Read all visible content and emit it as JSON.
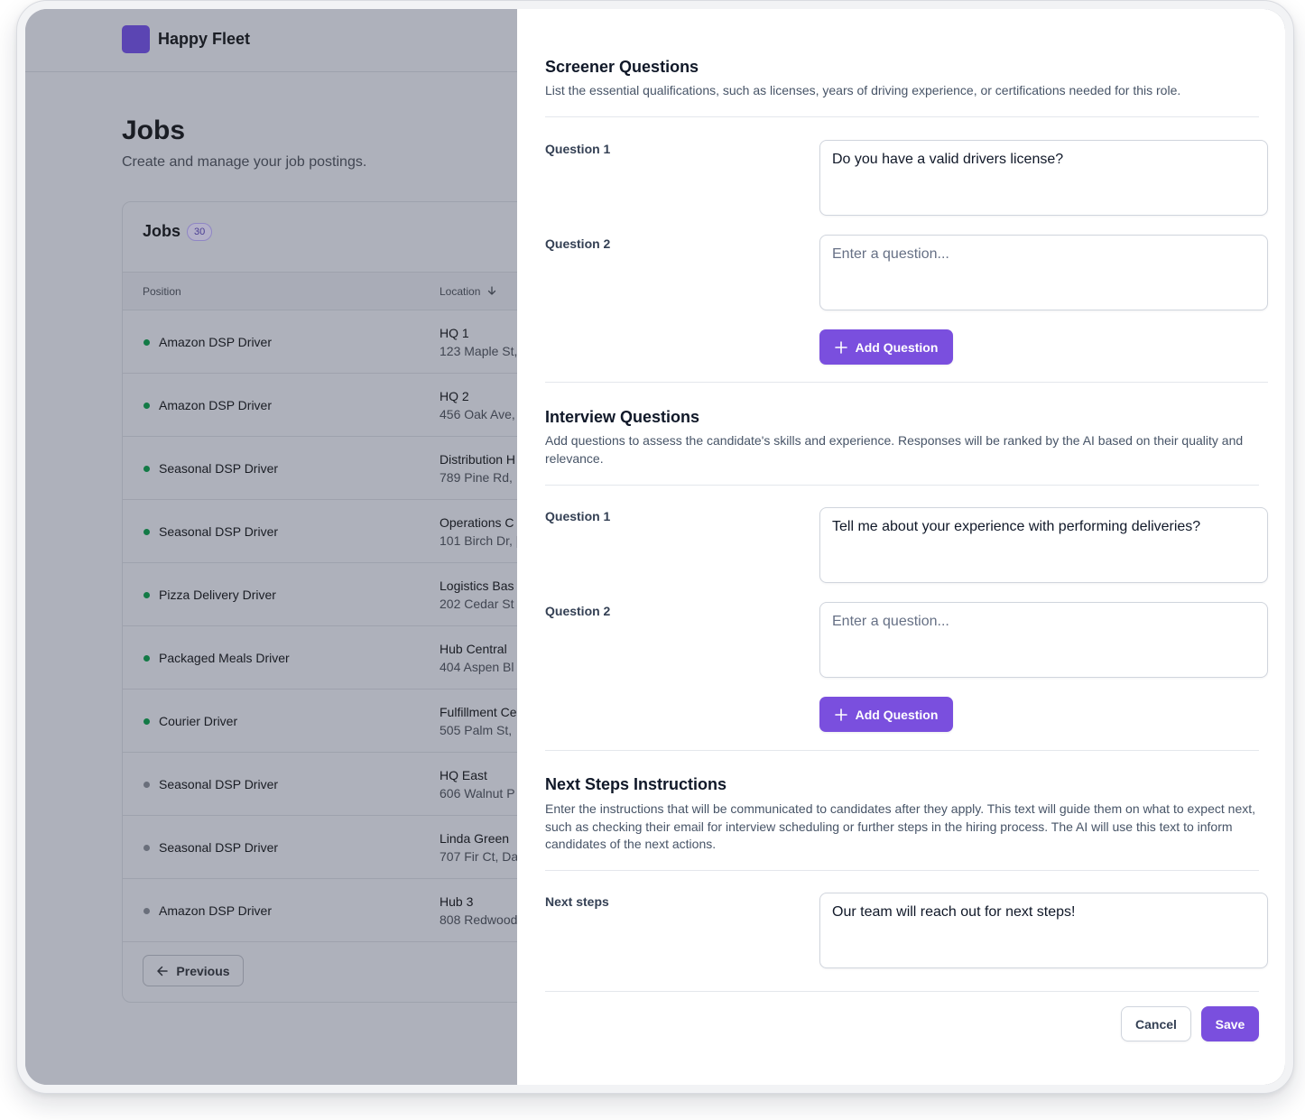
{
  "app": {
    "name": "Happy Fleet",
    "brand_color": "#5b45b3",
    "accent": "#7a4fde"
  },
  "jobs_page": {
    "title": "Jobs",
    "subtitle": "Create and manage your job postings.",
    "card_title": "Jobs",
    "count": "30",
    "columns": {
      "position": "Position",
      "location": "Location"
    },
    "rows": [
      {
        "position": "Amazon DSP Driver",
        "location": "HQ 1",
        "address": "123 Maple St,",
        "status": "active"
      },
      {
        "position": "Amazon DSP Driver",
        "location": "HQ 2",
        "address": "456 Oak Ave,",
        "status": "active"
      },
      {
        "position": "Seasonal DSP Driver",
        "location": "Distribution H",
        "address": "789 Pine Rd, ,",
        "status": "active"
      },
      {
        "position": "Seasonal DSP Driver",
        "location": "Operations C",
        "address": "101 Birch Dr, [",
        "status": "active"
      },
      {
        "position": "Pizza Delivery Driver",
        "location": "Logistics Bas",
        "address": "202 Cedar St",
        "status": "active"
      },
      {
        "position": "Packaged Meals Driver",
        "location": "Hub Central",
        "address": "404 Aspen Bl",
        "status": "active"
      },
      {
        "position": "Courier Driver",
        "location": "Fulfillment Ce",
        "address": "505 Palm St,",
        "status": "active"
      },
      {
        "position": "Seasonal DSP Driver",
        "location": "HQ East",
        "address": "606 Walnut P",
        "status": "inactive"
      },
      {
        "position": "Seasonal DSP Driver",
        "location": "Linda Green",
        "address": "707 Fir Ct, Da",
        "status": "inactive"
      },
      {
        "position": "Amazon DSP Driver",
        "location": "Hub 3",
        "address": "808 Redwood",
        "status": "inactive"
      }
    ],
    "previous_label": "Previous"
  },
  "panel": {
    "screener": {
      "title": "Screener Questions",
      "description": "List the essential qualifications, such as licenses, years of driving experience, or certifications needed for this role.",
      "q1_label": "Question 1",
      "q1_value": "Do you have a valid drivers license?",
      "q2_label": "Question 2",
      "q2_placeholder": "Enter a question...",
      "add_label": "Add Question"
    },
    "interview": {
      "title": "Interview Questions",
      "description": "Add questions to assess the candidate's skills and experience. Responses will be ranked by the AI based on their quality and relevance.",
      "q1_label": "Question 1",
      "q1_value": "Tell me about your experience with performing deliveries?",
      "q2_label": "Question 2",
      "q2_placeholder": "Enter a question...",
      "add_label": "Add Question"
    },
    "next_steps": {
      "title": "Next Steps Instructions",
      "description": "Enter the instructions that will be communicated to candidates after they apply. This text will guide them on what to expect next, such as checking their email for interview scheduling or further steps in the hiring process. The AI will use this text to inform candidates of the next actions.",
      "label": "Next steps",
      "value": "Our team will reach out for next steps!"
    },
    "cancel_label": "Cancel",
    "save_label": "Save"
  }
}
